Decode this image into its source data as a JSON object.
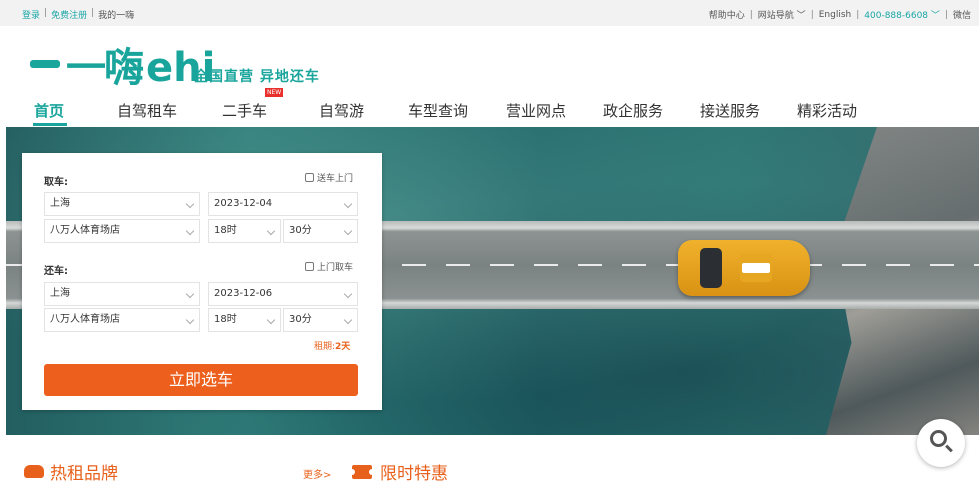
{
  "topbar": {
    "login": "登录",
    "register": "免费注册",
    "my_account": "我的一嗨",
    "help": "帮助中心",
    "site_nav": "网站导航",
    "english": "English",
    "phone": "400-888-6608",
    "wechat": "微信"
  },
  "brand": {
    "logo_text": "一嗨",
    "logo_latin": "ehi",
    "slogan": "全国直营 异地还车"
  },
  "nav": {
    "items": [
      "首页",
      "自驾租车",
      "二手车",
      "自驾游",
      "车型查询",
      "营业网点",
      "政企服务",
      "接送服务",
      "精彩活动"
    ],
    "new_badge": "NEW",
    "active_index": 0
  },
  "search": {
    "pickup_label": "取车:",
    "delivery_option": "送车上门",
    "pickup_city": "上海",
    "pickup_date": "2023-12-04",
    "pickup_store": "八万人体育场店",
    "pickup_hour": "18时",
    "pickup_minute": "30分",
    "return_label": "还车:",
    "collect_option": "上门取车",
    "return_city": "上海",
    "return_date": "2023-12-06",
    "return_store": "八万人体育场店",
    "return_hour": "18时",
    "return_minute": "30分",
    "rent_period_label": "租期:",
    "rent_period_value": "2天",
    "submit_label": "立即选车"
  },
  "sections": {
    "hot_brands": "热租品牌",
    "more": "更多>",
    "promotions": "限时特惠"
  },
  "colors": {
    "brand_teal": "#1aa59c",
    "accent_orange": "#ec5f1c"
  }
}
